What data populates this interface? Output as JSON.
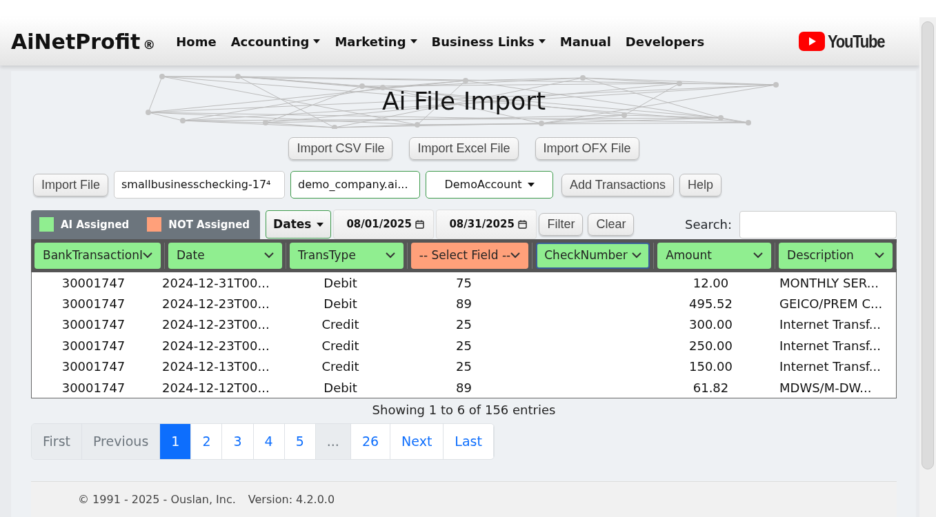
{
  "navbar": {
    "brand": "AiNetProfit",
    "brand_mark": "®",
    "items": [
      {
        "label": "Home",
        "dropdown": false
      },
      {
        "label": "Accounting",
        "dropdown": true
      },
      {
        "label": "Marketing",
        "dropdown": true
      },
      {
        "label": "Business Links",
        "dropdown": true
      },
      {
        "label": "Manual",
        "dropdown": false
      },
      {
        "label": "Developers",
        "dropdown": false
      }
    ],
    "youtube": "YouTube"
  },
  "title": "Ai File Import",
  "import_buttons": [
    "Import CSV File",
    "Import Excel File",
    "Import OFX File"
  ],
  "file_row": {
    "import_button": "Import File",
    "file_name": "smallbusinesschecking-17⁴",
    "company": "demo_company.ai...",
    "account": "DemoAccount",
    "add_button": "Add Transactions",
    "help_button": "Help"
  },
  "legend": [
    {
      "label": "AI Assigned",
      "color": "#90ee90"
    },
    {
      "label": "NOT Assigned",
      "color": "#ffa07a"
    }
  ],
  "filter": {
    "dates_button": "Dates",
    "from": "08/01/2025",
    "to": "08/31/2025",
    "filter_button": "Filter",
    "clear_button": "Clear",
    "search_label": "Search:"
  },
  "columns": [
    {
      "label": "BankTransactionI",
      "assigned": true,
      "focused": false
    },
    {
      "label": "Date",
      "assigned": true,
      "focused": false
    },
    {
      "label": "TransType",
      "assigned": true,
      "focused": false
    },
    {
      "label": "-- Select Field --",
      "assigned": false,
      "focused": false
    },
    {
      "label": "CheckNumber",
      "assigned": true,
      "focused": true
    },
    {
      "label": "Amount",
      "assigned": true,
      "focused": false
    },
    {
      "label": "Description",
      "assigned": true,
      "focused": false
    }
  ],
  "rows": [
    [
      "30001747",
      "2024-12-31T00...",
      "Debit",
      "75",
      "",
      "12.00",
      "MONTHLY SER..."
    ],
    [
      "30001747",
      "2024-12-23T00...",
      "Debit",
      "89",
      "",
      "495.52",
      "GEICO/PREM C..."
    ],
    [
      "30001747",
      "2024-12-23T00...",
      "Credit",
      "25",
      "",
      "300.00",
      "Internet Transf..."
    ],
    [
      "30001747",
      "2024-12-23T00...",
      "Credit",
      "25",
      "",
      "250.00",
      "Internet Transf..."
    ],
    [
      "30001747",
      "2024-12-13T00...",
      "Credit",
      "25",
      "",
      "150.00",
      "Internet Transf..."
    ],
    [
      "30001747",
      "2024-12-12T00...",
      "Debit",
      "89",
      "",
      "61.82",
      "MDWS/M-DW..."
    ]
  ],
  "info": "Showing 1 to 6 of 156 entries",
  "pagination": [
    {
      "label": "First",
      "selected": false,
      "disabled": true
    },
    {
      "label": "Previous",
      "selected": false,
      "disabled": true
    },
    {
      "label": "1",
      "selected": true,
      "disabled": false
    },
    {
      "label": "2",
      "selected": false,
      "disabled": false
    },
    {
      "label": "3",
      "selected": false,
      "disabled": false
    },
    {
      "label": "4",
      "selected": false,
      "disabled": false
    },
    {
      "label": "5",
      "selected": false,
      "disabled": false
    },
    {
      "label": "...",
      "selected": false,
      "disabled": true
    },
    {
      "label": "26",
      "selected": false,
      "disabled": false
    },
    {
      "label": "Next",
      "selected": false,
      "disabled": false
    },
    {
      "label": "Last",
      "selected": false,
      "disabled": false
    }
  ],
  "footer": {
    "copyright": "© 1991 - 2025 - Ouslan, Inc.",
    "version": "Version: 4.2.0.0"
  }
}
